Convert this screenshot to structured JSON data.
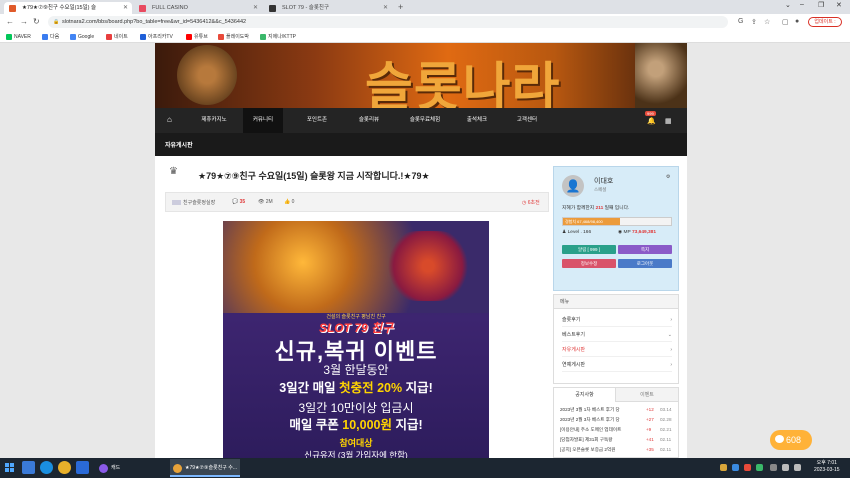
{
  "browser": {
    "tabs": [
      {
        "label": "★79★⑦⑨친구 수요일(15일) 슬",
        "active": true,
        "color": "#e05a2a"
      },
      {
        "label": "FULL CASINO",
        "active": false,
        "color": "#e84a5f"
      },
      {
        "label": "SLOT 79 - 슬롯친구",
        "active": false,
        "color": "#333333"
      }
    ],
    "url": "slotnara2.com/bbs/board.php?bo_table=free&wr_id=5436412&&c_5436442",
    "update_label": "업데이트 :",
    "bookmarks": [
      {
        "label": "NAVER",
        "color": "#03c75a"
      },
      {
        "label": "다음",
        "color": "#3a7cf0"
      },
      {
        "label": "Google",
        "color": "#4285f4"
      },
      {
        "label": "네이트",
        "color": "#e83e3e"
      },
      {
        "label": "아프리카TV",
        "color": "#1f5fd8"
      },
      {
        "label": "유튜브",
        "color": "#ff0000"
      },
      {
        "label": "플레이도박",
        "color": "#e84a3a"
      },
      {
        "label": "지에나/KTTP",
        "color": "#3ab86a"
      }
    ]
  },
  "site": {
    "logo_text": "슬롯나라",
    "nav": [
      {
        "label": "제휴카지노",
        "active": false
      },
      {
        "label": "커뮤니티",
        "active": true
      },
      {
        "label": "포인트존",
        "active": false
      },
      {
        "label": "슬롯리뷰",
        "active": false
      },
      {
        "label": "슬롯무료체험",
        "active": false
      },
      {
        "label": "출석체크",
        "active": false
      },
      {
        "label": "고객센터",
        "active": false
      }
    ],
    "notification_count": "999",
    "board_name": "자유게시판"
  },
  "post": {
    "title": "★79★⑦⑨친구 수요일(15일) 슬롯왕 지금 시작합니다.!★79★",
    "author": "친구슬롯정실장",
    "comments": "35",
    "views": "2M",
    "likes": "0",
    "time": "6초전"
  },
  "promo": {
    "small": "건설의 슬롯친구 평남친 친구",
    "brand": "SLOT 79 친구",
    "headline": "신규,복귀 이벤트",
    "line1": "3월 한달동안",
    "line2_pre": "3일간 매일 ",
    "line2_hl": "첫충전 20%",
    "line2_post": " 지급!",
    "line3": "3일간 10만이상 입금시",
    "line4_pre": "매일 쿠폰 ",
    "line4_hl": "10,000원",
    "line4_post": " 지급!",
    "target": "참여대상",
    "target_desc": "신규유저 (3월 가입자에 한함)"
  },
  "profile": {
    "username": "이대호",
    "role": "스페셜",
    "days_pre": "지혜가 함께한지 ",
    "days_num": "211",
    "days_post": " 일째 입니다.",
    "exp_text": "경험치 67,468/98,400",
    "exp_fraction": 0.53,
    "level": "Level . 166",
    "mp_label": "MP ",
    "mp_value": "73,649,381",
    "buttons": [
      {
        "label": "알림 [ 999 ]",
        "color": "#2aa08a"
      },
      {
        "label": "쪽지",
        "color": "#8a5ac8"
      },
      {
        "label": "정보수정",
        "color": "#d9536a"
      },
      {
        "label": "로그아웃",
        "color": "#4a7ac8"
      }
    ]
  },
  "menu": {
    "title": "메뉴",
    "items": [
      {
        "label": "슬롯후기",
        "arrow": "›",
        "active": false
      },
      {
        "label": "베스트후기",
        "arrow": "⌄",
        "active": false
      },
      {
        "label": "자유게시판",
        "arrow": "›",
        "active": true
      },
      {
        "label": "연예게시판",
        "arrow": "›",
        "active": false
      }
    ]
  },
  "notice": {
    "tab1": "공지사항",
    "tab2": "이벤트",
    "items": [
      {
        "label": "2023년 3월 1차 베스트 후기 당",
        "count": "+12",
        "date": "03.14"
      },
      {
        "label": "2023년 2월 3차 베스트 후기 당",
        "count": "+27",
        "date": "02.28"
      },
      {
        "label": "[이용안내] 주소 도메인 업데이트",
        "count": "+9",
        "date": "02.21"
      },
      {
        "label": "[당첨자발표] 제31회 구독왕",
        "count": "+41",
        "date": "02.11"
      },
      {
        "label": "[공지] 오픈슬롯 보증금 2억원",
        "count": "+35",
        "date": "02.11"
      }
    ]
  },
  "chat_count": "608",
  "taskbar": {
    "tasks": [
      {
        "label": "캐드",
        "color": "#8a5ae8",
        "active": false
      },
      {
        "label": "★79★⑦⑨슬롯친구 수...",
        "color": "#e8a33a",
        "active": true
      }
    ],
    "time": "오후 7:01",
    "date": "2023-03-15"
  }
}
